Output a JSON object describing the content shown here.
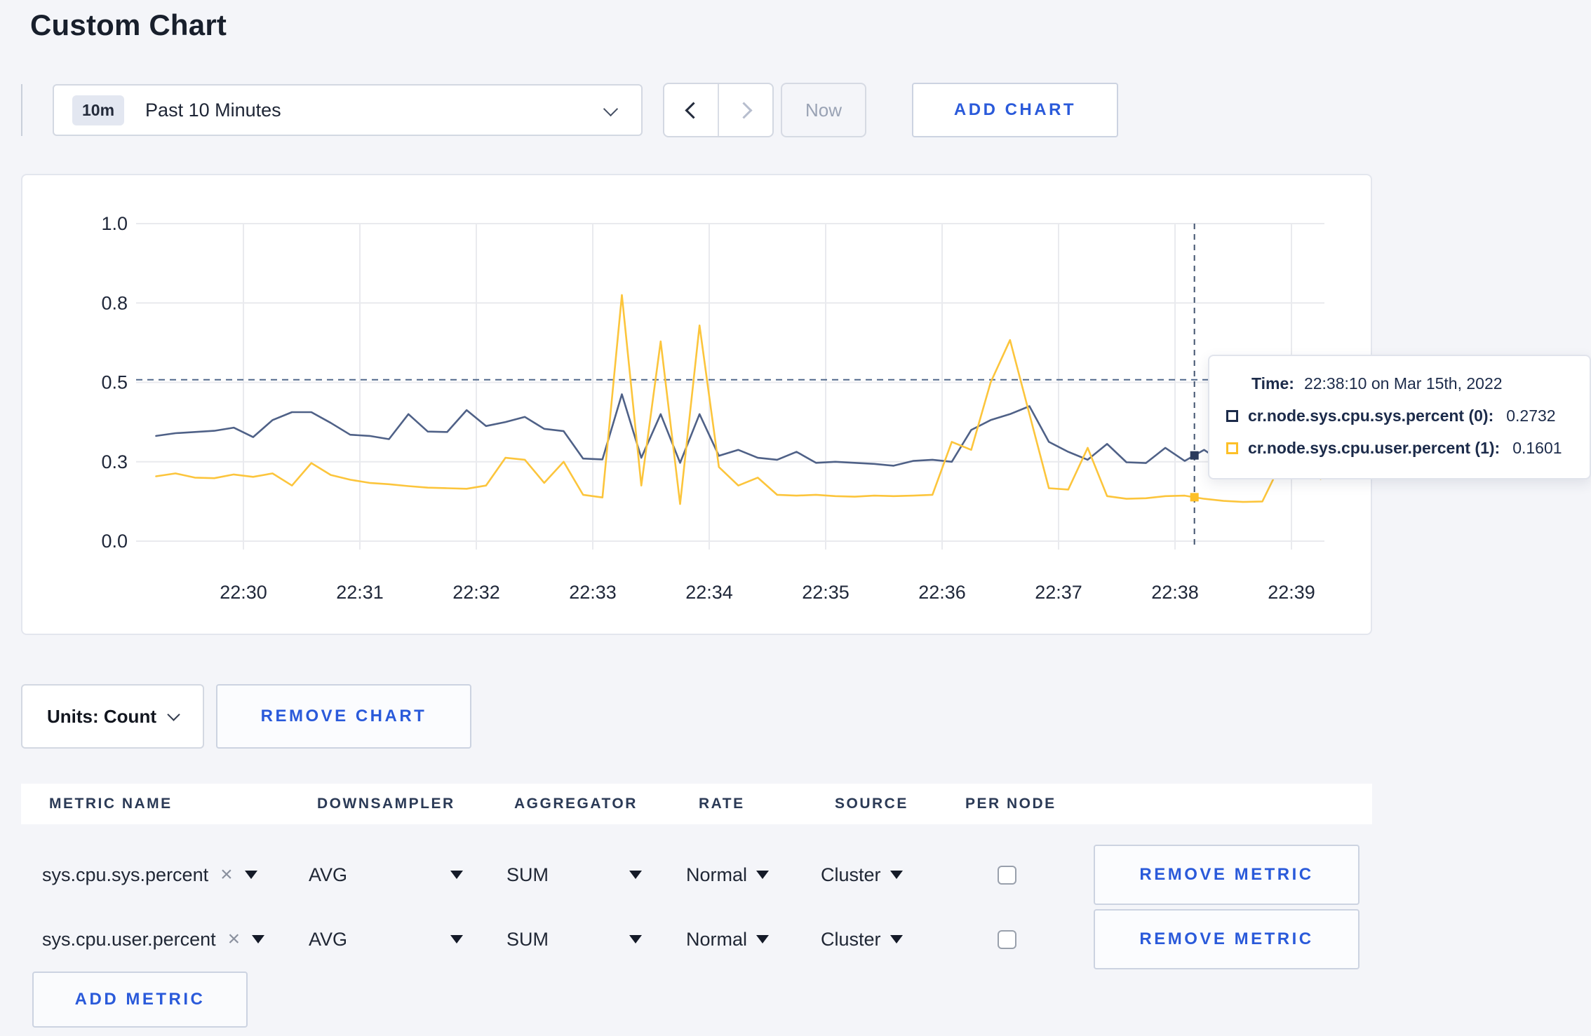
{
  "page": {
    "title": "Custom Chart"
  },
  "colors": {
    "accent_blue": "#2a5ada",
    "series_sys": "#1c2b4a",
    "series_sys_line": "#4f6187",
    "series_user": "#fdc028",
    "series_user_line": "#fcc53c",
    "crosshair": "#41536e",
    "grid": "#e9eaee"
  },
  "toolbar": {
    "time_range": {
      "badge": "10m",
      "label": "Past 10 Minutes"
    },
    "now_label": "Now",
    "add_chart_label": "ADD CHART",
    "icons": {
      "dropdown": "chevron-down",
      "prev": "chevron-left",
      "next": "chevron-right"
    }
  },
  "chart_data": {
    "type": "line",
    "title": "",
    "xlabel": "",
    "ylabel": "",
    "grid": true,
    "x_tick_labels": [
      "22:30",
      "22:31",
      "22:32",
      "22:33",
      "22:34",
      "22:35",
      "22:36",
      "22:37",
      "22:38",
      "22:39"
    ],
    "y_tick_labels": [
      "0.0",
      "0.3",
      "0.5",
      "0.8",
      "1.0"
    ],
    "y_tick_values": [
      0.0,
      0.3,
      0.5,
      0.8,
      1.0
    ],
    "ylim_note": "ticks evenly spaced on screen",
    "start_min": 29.25,
    "step_min": 0.1666667,
    "time_base": "22:00",
    "series": [
      {
        "name": "cr.node.sys.cpu.sys.percent (0)",
        "line_color": "#4f6187",
        "dot_color": "#2a3a5c",
        "values": [
          0.365,
          0.372,
          0.375,
          0.378,
          0.386,
          0.362,
          0.405,
          0.425,
          0.425,
          0.398,
          0.368,
          0.365,
          0.357,
          0.42,
          0.376,
          0.375,
          0.43,
          0.39,
          0.4,
          0.413,
          0.383,
          0.377,
          0.308,
          0.306,
          0.47,
          0.31,
          0.42,
          0.296,
          0.42,
          0.315,
          0.33,
          0.31,
          0.305,
          0.325,
          0.296,
          0.3,
          0.296,
          0.292,
          0.285,
          0.302,
          0.305,
          0.3,
          0.38,
          0.405,
          0.42,
          0.44,
          0.35,
          0.325,
          0.305,
          0.345,
          0.298,
          0.295,
          0.335,
          0.302,
          0.33,
          0.295,
          0.29,
          0.295,
          0.3,
          0.303,
          0.298
        ]
      },
      {
        "name": "cr.node.sys.cpu.user.percent (1)",
        "line_color": "#fcc53c",
        "dot_color": "#fdc028",
        "values": [
          0.245,
          0.256,
          0.24,
          0.238,
          0.252,
          0.243,
          0.256,
          0.21,
          0.295,
          0.25,
          0.232,
          0.22,
          0.215,
          0.208,
          0.202,
          0.2,
          0.198,
          0.21,
          0.31,
          0.305,
          0.22,
          0.3,
          0.175,
          0.165,
          0.82,
          0.21,
          0.655,
          0.14,
          0.715,
          0.28,
          0.21,
          0.24,
          0.175,
          0.172,
          0.175,
          0.17,
          0.168,
          0.172,
          0.17,
          0.172,
          0.175,
          0.35,
          0.33,
          0.5,
          0.66,
          0.42,
          0.2,
          0.195,
          0.335,
          0.17,
          0.16,
          0.162,
          0.17,
          0.172,
          0.16,
          0.152,
          0.148,
          0.15,
          0.3,
          0.295,
          0.235
        ]
      }
    ],
    "hover": {
      "time_min": 38.1667,
      "hline_value": 0.51
    }
  },
  "tooltip": {
    "time_label": "Time:",
    "time_value": "22:38:10 on Mar 15th, 2022",
    "rows": [
      {
        "name": "cr.node.sys.cpu.sys.percent (0):",
        "value": "0.2732"
      },
      {
        "name": "cr.node.sys.cpu.user.percent (1):",
        "value": "0.1601"
      }
    ]
  },
  "chart_controls": {
    "units_label": "Units: Count",
    "remove_chart_label": "REMOVE CHART"
  },
  "metrics_table": {
    "headers": [
      "METRIC NAME",
      "DOWNSAMPLER",
      "AGGREGATOR",
      "RATE",
      "SOURCE",
      "PER NODE"
    ],
    "close_icon": "×",
    "rows": [
      {
        "metric": "sys.cpu.sys.percent",
        "downsampler": "AVG",
        "aggregator": "SUM",
        "rate": "Normal",
        "source": "Cluster",
        "per_node_checked": false,
        "remove_label": "REMOVE METRIC"
      },
      {
        "metric": "sys.cpu.user.percent",
        "downsampler": "AVG",
        "aggregator": "SUM",
        "rate": "Normal",
        "source": "Cluster",
        "per_node_checked": false,
        "remove_label": "REMOVE METRIC"
      }
    ],
    "add_metric_label": "ADD METRIC"
  }
}
